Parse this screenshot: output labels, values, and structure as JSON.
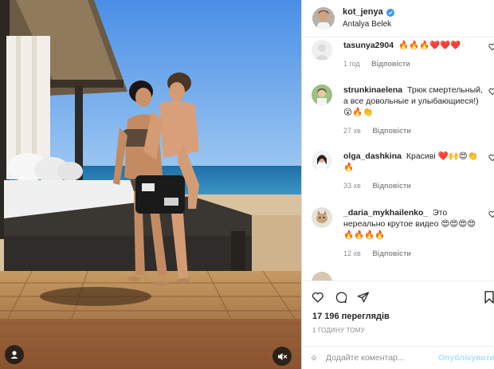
{
  "header": {
    "username": "kot_jenya",
    "location": "Antalya Belek",
    "verified": true
  },
  "comments": [
    {
      "username": "tasunya2904",
      "text": "🔥🔥🔥❤️❤️❤️",
      "time": "1 год",
      "reply": "Відповісти"
    },
    {
      "username": "strunkinaelena",
      "text": "Трюк смертельный, а все довольные и улыбающиеся!)😮🔥👏",
      "time": "27 хв",
      "reply": "Відповісти"
    },
    {
      "username": "olga_dashkina",
      "text": "Красиві ❤️🙌😍👏🔥",
      "time": "33 хв",
      "reply": "Відповісти"
    },
    {
      "username": "_daria_mykhailenko_",
      "text": "Это нереально крутое видео 😍😍😍😍🔥🔥🔥🔥",
      "time": "12 хв",
      "reply": "Відповісти"
    }
  ],
  "actions": {
    "views": "17 196 переглядів",
    "date": "1 ГОДИНУ ТОМУ"
  },
  "add_comment": {
    "placeholder": "Додайте коментар...",
    "publish_label": "Опублікувати"
  },
  "icons": {
    "like": "heart-icon",
    "comment": "comment-icon",
    "share": "paper-plane-icon",
    "save": "bookmark-icon",
    "emoji": "smiley-icon",
    "tags": "user-tag-icon",
    "mute": "speaker-muted-icon"
  },
  "colors": {
    "verified": "#3897f0",
    "publish_disabled": "#b2dffc",
    "meta_gray": "#8e8e8e"
  }
}
